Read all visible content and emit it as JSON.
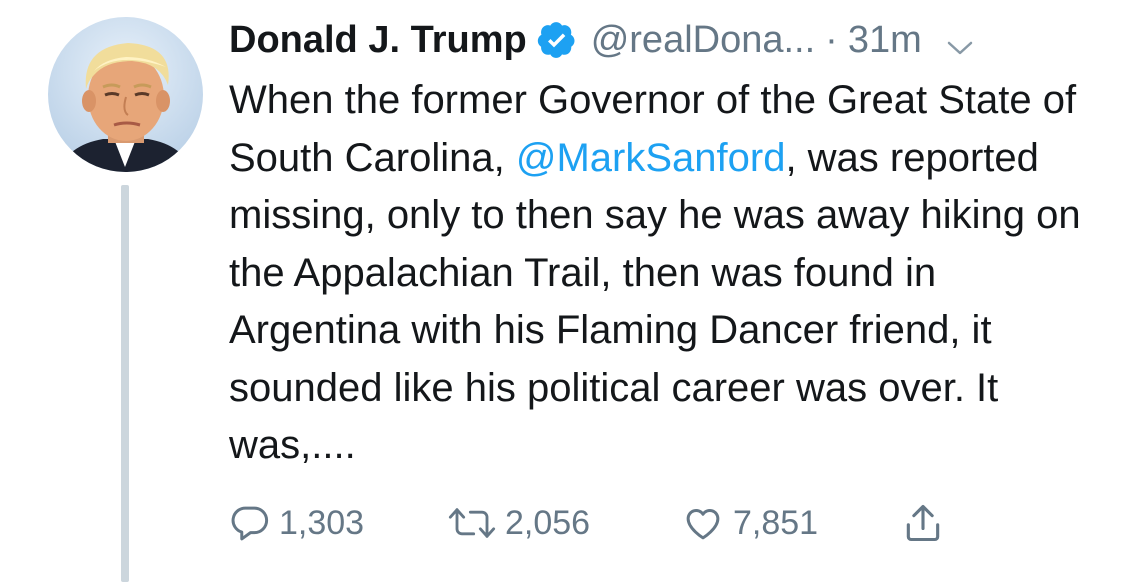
{
  "tweet": {
    "display_name": "Donald J. Trump",
    "verified_icon": "verified-badge-icon",
    "handle": "@realDona...",
    "separator": "·",
    "time_ago": "31m",
    "menu_icon": "chevron-down-icon",
    "text_before_mention": "When the former Governor of the Great State of South Carolina, ",
    "mention": "@MarkSanford",
    "text_after_mention": ", was reported missing, only to then say he was away hiking on the Appalachian Trail, then was found in Argentina with his Flaming Dancer friend, it sounded like his political career was over. It was,...."
  },
  "actions": {
    "reply": {
      "icon": "reply-icon",
      "count": "1,303"
    },
    "retweet": {
      "icon": "retweet-icon",
      "count": "2,056"
    },
    "like": {
      "icon": "heart-icon",
      "count": "7,851"
    },
    "share": {
      "icon": "share-icon"
    }
  },
  "colors": {
    "text": "#14171a",
    "muted": "#657786",
    "link": "#1da1f2",
    "verified": "#1da1f2",
    "thread_line": "#ccd6dd"
  }
}
